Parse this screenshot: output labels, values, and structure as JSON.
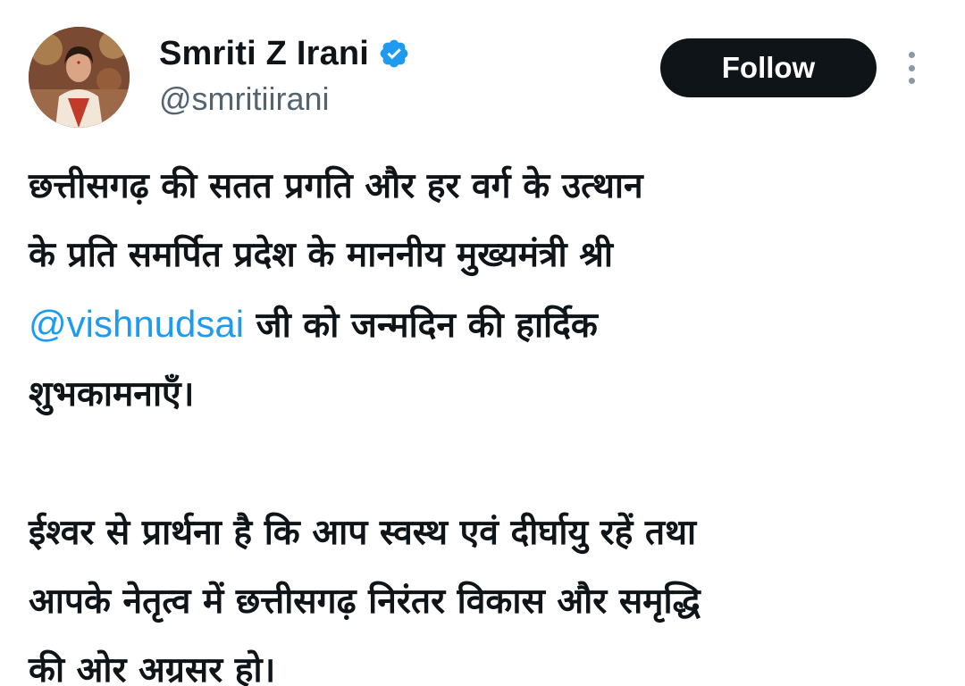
{
  "author": {
    "display_name": "Smriti Z Irani",
    "handle": "@smritiirani",
    "verified_icon": "verified-badge-icon"
  },
  "actions": {
    "follow_label": "Follow",
    "more_icon": "more-vertical-icon"
  },
  "tweet": {
    "line1": "छत्तीसगढ़ की सतत प्रगति और हर वर्ग के उत्थान",
    "line2": "के प्रति समर्पित प्रदेश के माननीय मुख्यमंत्री श्री",
    "mention": "@vishnudsai",
    "line3_rest": " जी को जन्मदिन की हार्दिक",
    "line4": "शुभकामनाएँ।",
    "line5": "ईश्वर से प्रार्थना है कि आप स्वस्थ एवं दीर्घायु रहें तथा",
    "line6": "आपके नेतृत्व में छत्तीसगढ़ निरंतर विकास और समृद्धि",
    "line7": "की ओर अग्रसर हो।"
  },
  "colors": {
    "text": "#0f1419",
    "secondary": "#536471",
    "link": "#1d9bf0",
    "button_bg": "#0f1419",
    "button_text": "#ffffff"
  }
}
